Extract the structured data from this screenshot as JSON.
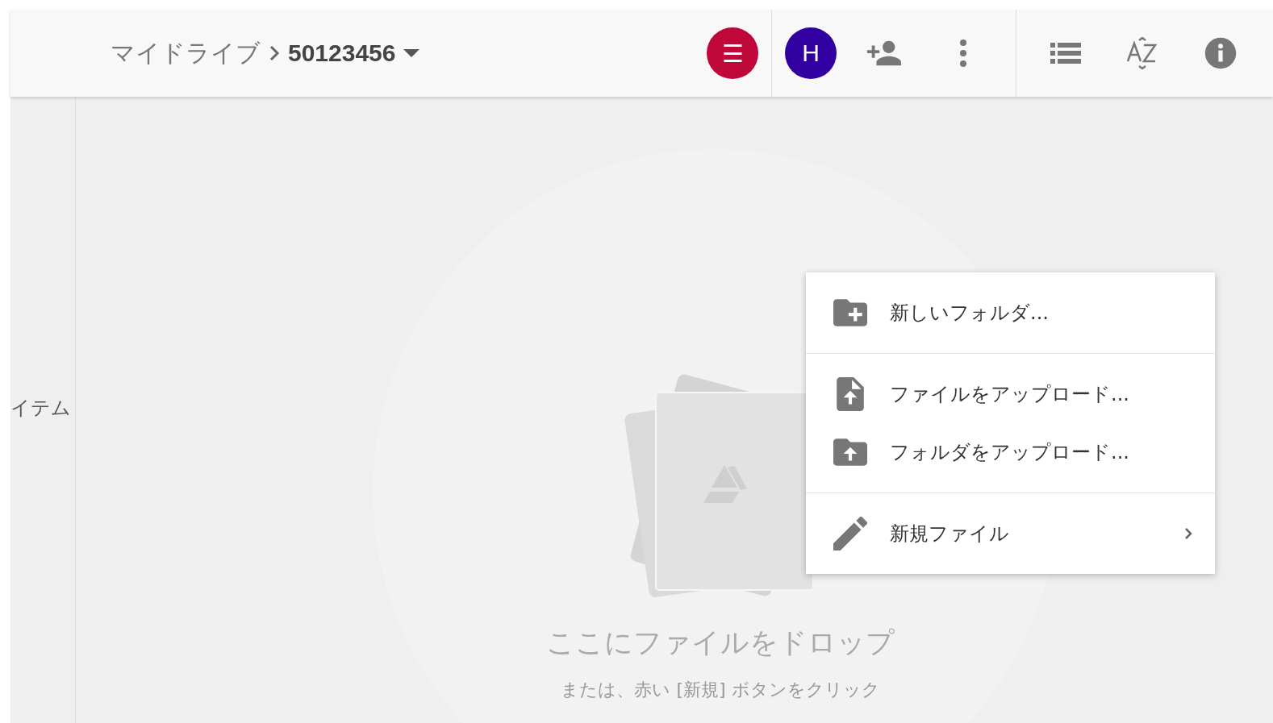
{
  "header": {
    "breadcrumb": [
      {
        "label": "マイドライブ",
        "current": false
      },
      {
        "label": "50123456",
        "current": true
      }
    ],
    "new_button": {
      "label": "☰"
    },
    "account": {
      "initial": "H"
    }
  },
  "sidebar": {
    "items": [
      {
        "label": "イテム"
      }
    ]
  },
  "empty_state": {
    "title": "ここにファイルをドロップ",
    "subtitle": "または、赤い [新規] ボタンをクリック"
  },
  "menu": {
    "groups": [
      [
        {
          "kind": "new-folder",
          "label": "新しいフォルダ...",
          "has_submenu": false
        }
      ],
      [
        {
          "kind": "upload-file",
          "label": "ファイルをアップロード...",
          "has_submenu": false
        },
        {
          "kind": "upload-folder",
          "label": "フォルダをアップロード...",
          "has_submenu": false
        }
      ],
      [
        {
          "kind": "new-file",
          "label": "新規ファイル",
          "has_submenu": true
        }
      ]
    ]
  }
}
